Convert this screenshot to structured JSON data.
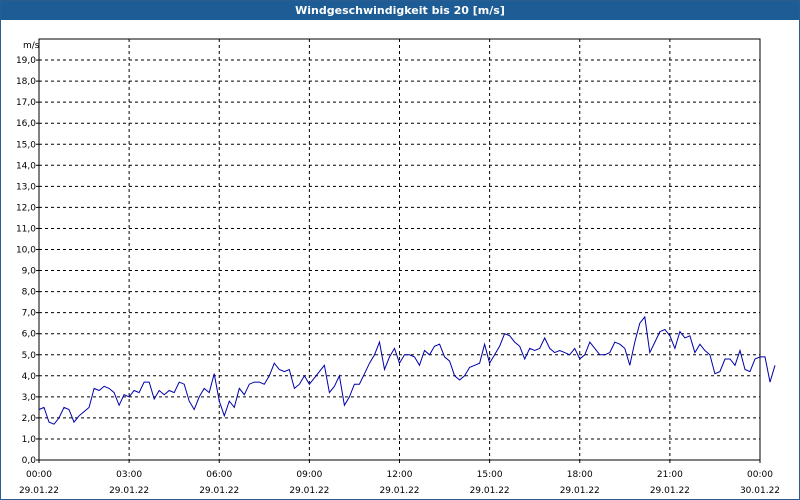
{
  "title": "Windgeschwindigkeit bis 20 [m/s]",
  "colors": {
    "titlebar": "#1d5c94",
    "series": "#0000aa",
    "grid": "#000000"
  },
  "chart_data": {
    "type": "line",
    "title": "Windgeschwindigkeit bis 20 [m/s]",
    "ylabel": "m/s",
    "ylim": [
      0,
      20
    ],
    "yticks": [
      "0,0",
      "1,0",
      "2,0",
      "3,0",
      "4,0",
      "5,0",
      "6,0",
      "7,0",
      "8,0",
      "9,0",
      "10,0",
      "11,0",
      "12,0",
      "13,0",
      "14,0",
      "15,0",
      "16,0",
      "17,0",
      "18,0",
      "19,0"
    ],
    "xlim_hours": [
      0,
      24
    ],
    "xticks": [
      {
        "time": "00:00",
        "date": "29.01.22"
      },
      {
        "time": "03:00",
        "date": "29.01.22"
      },
      {
        "time": "06:00",
        "date": "29.01.22"
      },
      {
        "time": "09:00",
        "date": "29.01.22"
      },
      {
        "time": "12:00",
        "date": "29.01.22"
      },
      {
        "time": "15:00",
        "date": "29.01.22"
      },
      {
        "time": "18:00",
        "date": "29.01.22"
      },
      {
        "time": "21:00",
        "date": "29.01.22"
      },
      {
        "time": "00:00",
        "date": "30.01.22"
      }
    ],
    "grid": true,
    "series": [
      {
        "color": "#0000aa",
        "interval_minutes": 10,
        "values": [
          2.4,
          2.5,
          1.8,
          1.7,
          2.0,
          2.5,
          2.4,
          1.8,
          2.1,
          2.3,
          2.5,
          3.4,
          3.3,
          3.5,
          3.4,
          3.2,
          2.6,
          3.1,
          3.0,
          3.3,
          3.2,
          3.7,
          3.7,
          2.9,
          3.3,
          3.1,
          3.3,
          3.2,
          3.7,
          3.6,
          2.8,
          2.4,
          3.0,
          3.4,
          3.2,
          4.1,
          2.8,
          2.1,
          2.8,
          2.5,
          3.4,
          3.1,
          3.6,
          3.7,
          3.7,
          3.6,
          4.0,
          4.6,
          4.3,
          4.2,
          4.3,
          3.4,
          3.6,
          4.0,
          3.6,
          3.9,
          4.2,
          4.5,
          3.2,
          3.5,
          4.0,
          2.6,
          3.0,
          3.6,
          3.6,
          4.1,
          4.6,
          5.0,
          5.6,
          4.3,
          4.9,
          5.3,
          4.6,
          5.0,
          5.0,
          4.9,
          4.5,
          5.2,
          5.0,
          5.4,
          5.5,
          4.9,
          4.7,
          4.0,
          3.8,
          4.0,
          4.4,
          4.5,
          4.6,
          5.5,
          4.6,
          5.0,
          5.4,
          6.0,
          5.9,
          5.6,
          5.4,
          4.8,
          5.3,
          5.2,
          5.3,
          5.8,
          5.3,
          5.1,
          5.2,
          5.1,
          5.0,
          5.3,
          4.8,
          5.0,
          5.6,
          5.3,
          5.0,
          5.0,
          5.1,
          5.6,
          5.5,
          5.3,
          4.5,
          5.6,
          6.5,
          6.8,
          5.1,
          5.6,
          6.1,
          6.2,
          5.9,
          5.3,
          6.1,
          5.8,
          5.9,
          5.1,
          5.5,
          5.2,
          5.0,
          4.1,
          4.2,
          4.8,
          4.8,
          4.5,
          5.2,
          4.3,
          4.2,
          4.8,
          4.9,
          4.9,
          3.7,
          4.5
        ]
      }
    ]
  }
}
